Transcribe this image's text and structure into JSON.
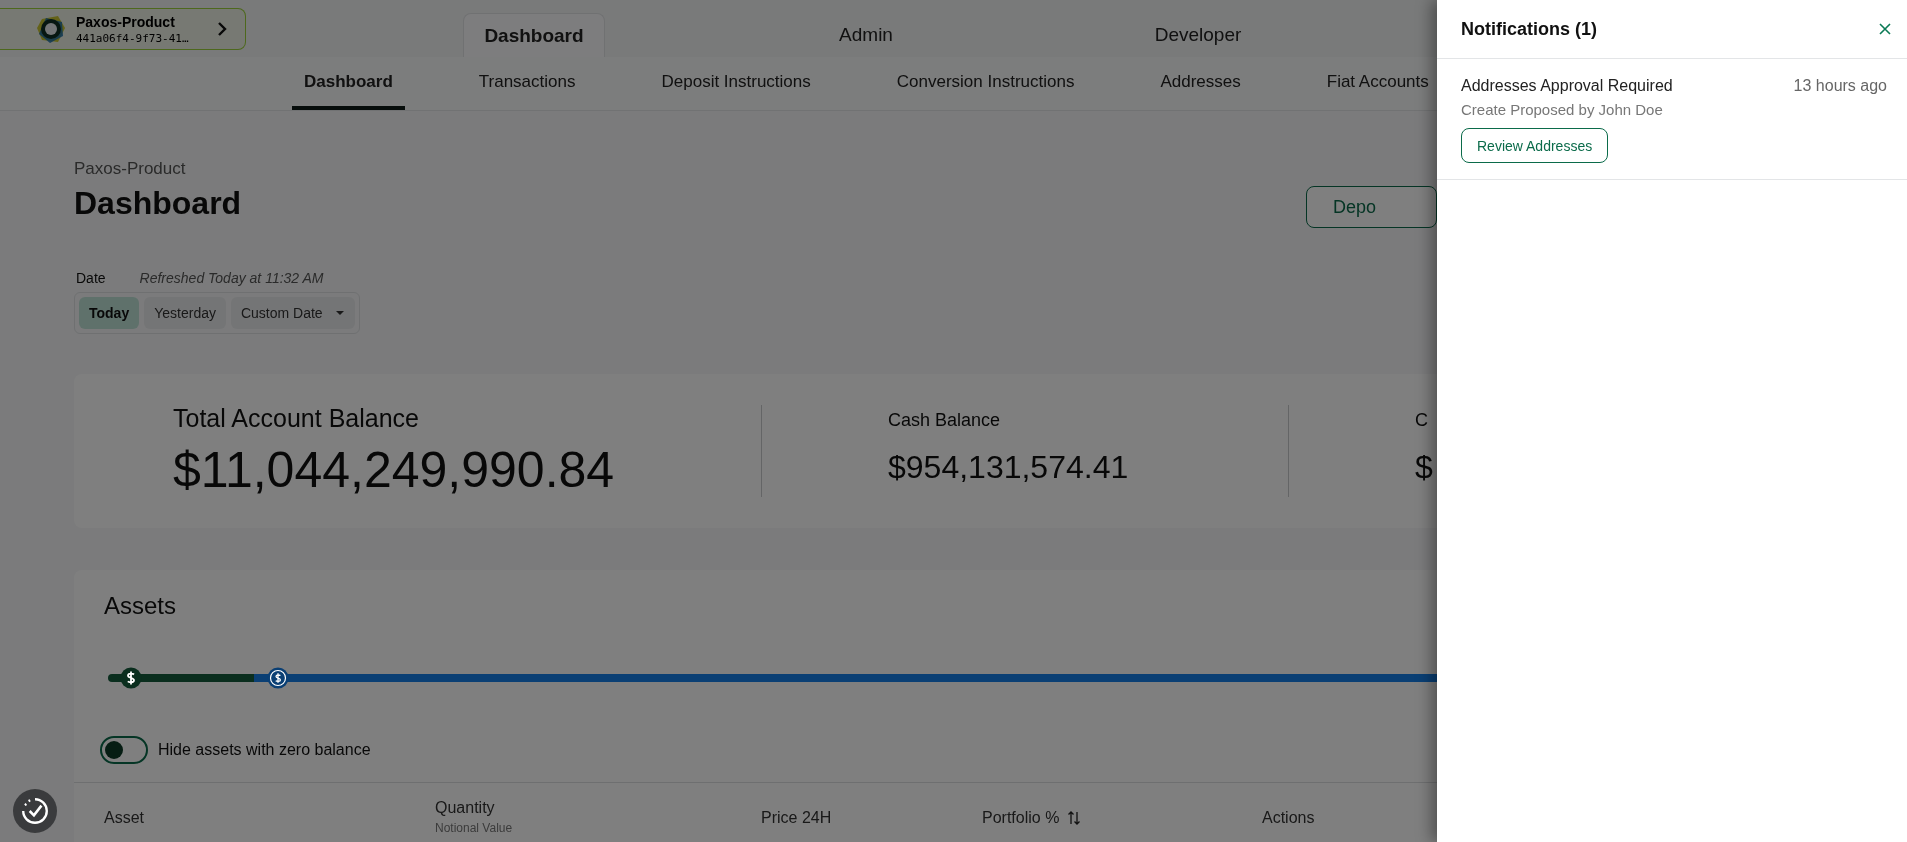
{
  "org_switcher": {
    "name": "Paxos-Product",
    "id": "441a06f4-9f73-41…"
  },
  "top_tabs": [
    {
      "label": "Dashboard",
      "selected": true
    },
    {
      "label": "Admin",
      "selected": false
    },
    {
      "label": "Developer",
      "selected": false
    }
  ],
  "sub_tabs": [
    {
      "label": "Dashboard",
      "selected": true
    },
    {
      "label": "Transactions",
      "selected": false
    },
    {
      "label": "Deposit Instructions",
      "selected": false
    },
    {
      "label": "Conversion Instructions",
      "selected": false
    },
    {
      "label": "Addresses",
      "selected": false
    },
    {
      "label": "Fiat Accounts",
      "selected": false
    }
  ],
  "page": {
    "breadcrumb": "Paxos-Product",
    "title": "Dashboard",
    "action_button": "Depo"
  },
  "date_filter": {
    "label": "Date",
    "refreshed": "Refreshed Today at 11:32 AM",
    "options": [
      {
        "label": "Today",
        "selected": true,
        "kind": "option"
      },
      {
        "label": "Yesterday",
        "selected": false,
        "kind": "option"
      },
      {
        "label": "Custom Date",
        "selected": false,
        "kind": "dropdown"
      }
    ]
  },
  "balances": [
    {
      "label": "Total Account Balance",
      "value": "$11,044,249,990.84",
      "kind": "primary"
    },
    {
      "label": "Cash Balance",
      "value": "$954,131,574.41",
      "kind": "secondary"
    },
    {
      "label": "C",
      "value": "$",
      "kind": "secondary"
    }
  ],
  "assets": {
    "title": "Assets",
    "allocation": [
      {
        "color": "#0a2e1e",
        "kind": "filled"
      },
      {
        "color": "#0a3f74",
        "kind": "ring"
      }
    ],
    "hide_zero_toggle": {
      "label": "Hide assets with zero balance",
      "on": false
    },
    "columns": [
      {
        "label": "Asset"
      },
      {
        "label": "Quantity",
        "sublabel": "Notional Value"
      },
      {
        "label": "Price 24H"
      },
      {
        "label": "Portfolio %",
        "sortable": true
      },
      {
        "label": "Actions"
      }
    ]
  },
  "notifications": {
    "title": "Notifications (1)",
    "items": [
      {
        "title": "Addresses Approval Required",
        "subtitle": "Create Proposed by John Doe",
        "time": "13 hours ago",
        "action": "Review Addresses"
      }
    ]
  }
}
